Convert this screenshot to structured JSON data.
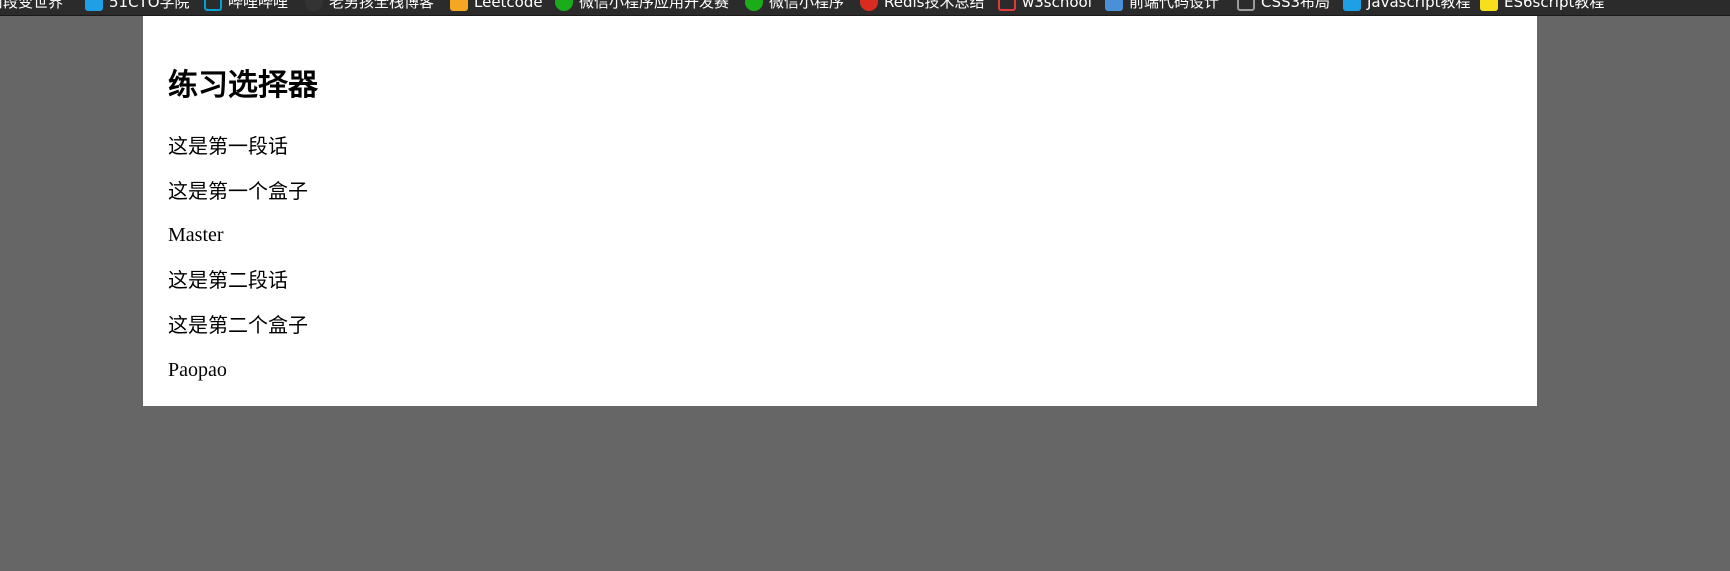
{
  "bookmarks": [
    {
      "label": "前段变世界",
      "icon": "none",
      "color": ""
    },
    {
      "label": "51CTO学院",
      "icon": "51cto-icon",
      "color": "#1fa0e6"
    },
    {
      "label": "哔哩哔哩",
      "icon": "bilibili-icon",
      "color": "#00a1d6"
    },
    {
      "label": "老男孩全栈博客",
      "icon": "github-icon",
      "color": "#333333"
    },
    {
      "label": "Leetcode",
      "icon": "leetcode-icon",
      "color": "#f5a623"
    },
    {
      "label": "微信小程序应用开发赛",
      "icon": "wechat-icon",
      "color": "#1aad19"
    },
    {
      "label": "微信小程序",
      "icon": "wechat-icon",
      "color": "#1aad19"
    },
    {
      "label": "Redis技术总结",
      "icon": "redis-icon",
      "color": "#d82c20"
    },
    {
      "label": "w3school",
      "icon": "w3school-icon",
      "color": "#e33b3b"
    },
    {
      "label": "前端代码设计",
      "icon": "design-icon",
      "color": "#4a90d9"
    },
    {
      "label": "CSS3布局",
      "icon": "folder-icon",
      "color": "#9a9a9a"
    },
    {
      "label": "Javascript教程",
      "icon": "js-tutorial-icon",
      "color": "#1fa0e6"
    },
    {
      "label": "ES6script教程",
      "icon": "es6-icon",
      "color": "#f7df1e"
    }
  ],
  "page": {
    "title": "练习选择器",
    "lines": [
      "这是第一段话",
      "这是第一个盒子",
      "Master",
      "这是第二段话",
      "这是第二个盒子",
      "Paopao"
    ]
  },
  "colors": {
    "background": "#666666",
    "page": "#ffffff",
    "bookmarks_bar": "#2b2b2b"
  }
}
